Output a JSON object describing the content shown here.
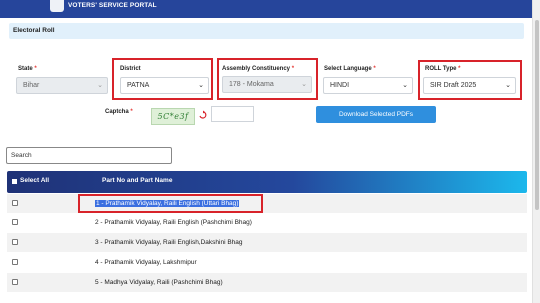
{
  "header": {
    "title": "VOTERS' SERVICE PORTAL"
  },
  "section": {
    "title": "Electoral Roll"
  },
  "filters": {
    "state": {
      "label": "State",
      "req": "*",
      "value": "Bihar"
    },
    "district": {
      "label": "District",
      "value": "PATNA"
    },
    "ac": {
      "label": "Assembly Constituency",
      "req": "*",
      "value": "178 - Mokama"
    },
    "language": {
      "label": "Select Language",
      "req": "*",
      "value": "HINDI"
    },
    "roll": {
      "label": "ROLL Type",
      "req": "*",
      "value": "SIR Draft 2025"
    }
  },
  "captcha": {
    "label": "Captcha",
    "req": "*",
    "image_text": "5C*e3f"
  },
  "download": {
    "label": "Download Selected PDFs"
  },
  "search": {
    "placeholder": "Search"
  },
  "table": {
    "select_all": "Select All",
    "column": "Part No and Part Name",
    "rows": [
      "1 - Prathamik Vidyalay, Raili English (Uttari Bhag)",
      "2 - Prathamik Vidyalay, Raili English (Pashchimi Bhag)",
      "3 - Prathamik Vidyalay, Raili English,Dakshini Bhag",
      "4 - Prathamik Vidyalay, Lakshmipur",
      "5 - Madhya Vidyalay, Raili (Pashchimi Bhag)"
    ]
  },
  "colors": {
    "brand": "#26459b",
    "accent": "#2f8fde",
    "highlight": "#d8232a"
  }
}
